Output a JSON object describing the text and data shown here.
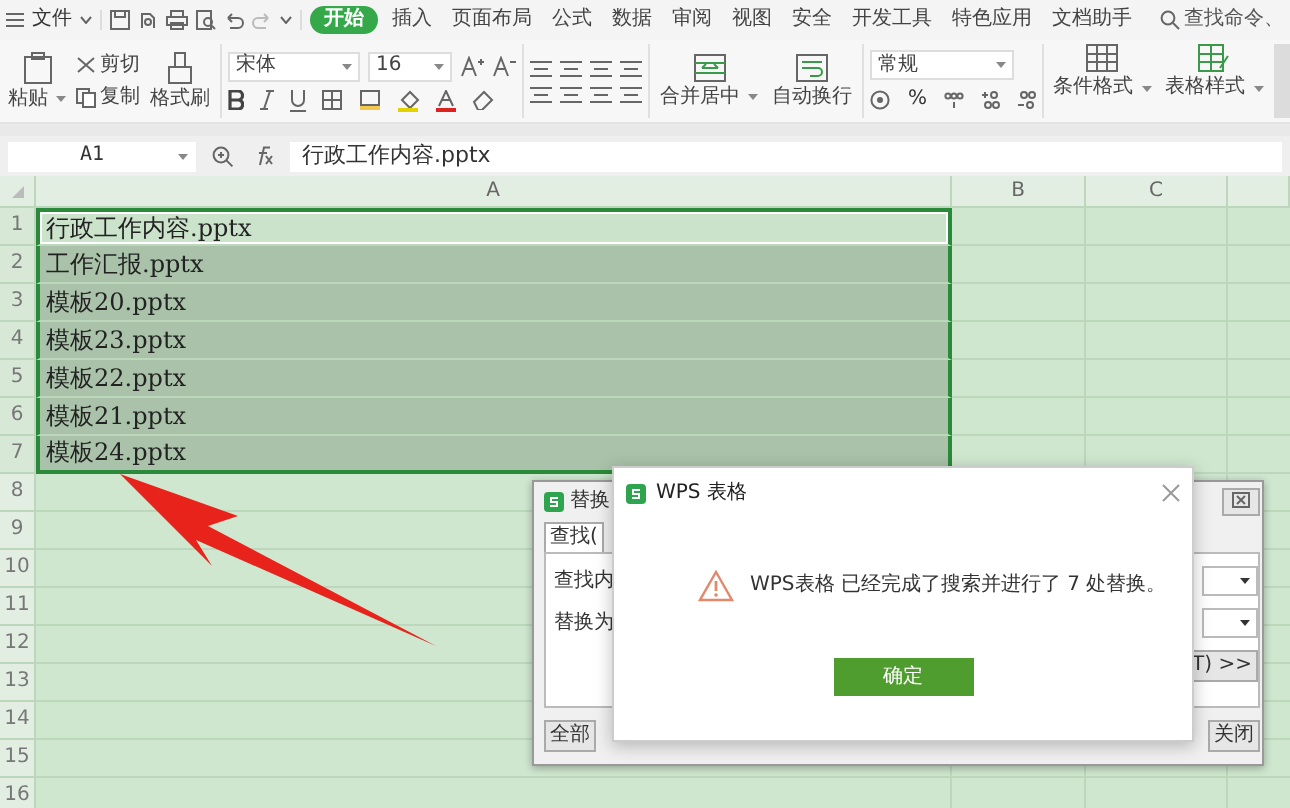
{
  "menu_bar": {
    "file_menu": "文件",
    "tabs": [
      {
        "label": "开始",
        "selected": true
      },
      {
        "label": "插入",
        "selected": false
      },
      {
        "label": "页面布局",
        "selected": false
      },
      {
        "label": "公式",
        "selected": false
      },
      {
        "label": "数据",
        "selected": false
      },
      {
        "label": "审阅",
        "selected": false
      },
      {
        "label": "视图",
        "selected": false
      },
      {
        "label": "安全",
        "selected": false
      },
      {
        "label": "开发工具",
        "selected": false
      },
      {
        "label": "特色应用",
        "selected": false
      },
      {
        "label": "文档助手",
        "selected": false
      }
    ],
    "search": {
      "placeholder": "查找命令、"
    }
  },
  "ribbon": {
    "paste": "粘贴",
    "cut": "剪切",
    "copy": "复制",
    "format_painter": "格式刷",
    "font_name": "宋体",
    "font_size": "16",
    "percent": "%",
    "merge_center": "合并居中",
    "wrap_text": "自动换行",
    "number_format": "常规",
    "conditional_format": "条件格式",
    "table_style": "表格样式"
  },
  "formula_bar": {
    "name_box": "A1",
    "formula": "行政工作内容.pptx"
  },
  "sheet": {
    "columns": [
      "A",
      "B",
      "C"
    ],
    "rows": [
      {
        "number": "1",
        "cell_a": "行政工作内容.pptx",
        "selected": true,
        "active": true
      },
      {
        "number": "2",
        "cell_a": "工作汇报.pptx",
        "selected": true,
        "active": false
      },
      {
        "number": "3",
        "cell_a": "模板20.pptx",
        "selected": true,
        "active": false
      },
      {
        "number": "4",
        "cell_a": "模板23.pptx",
        "selected": true,
        "active": false
      },
      {
        "number": "5",
        "cell_a": "模板22.pptx",
        "selected": true,
        "active": false
      },
      {
        "number": "6",
        "cell_a": "模板21.pptx",
        "selected": true,
        "active": false
      },
      {
        "number": "7",
        "cell_a": "模板24.pptx",
        "selected": true,
        "active": false
      },
      {
        "number": "8",
        "selected": false,
        "active": false
      },
      {
        "number": "9",
        "selected": false,
        "active": false
      },
      {
        "number": "10",
        "selected": false,
        "active": false
      },
      {
        "number": "11",
        "selected": false,
        "active": false
      },
      {
        "number": "12",
        "selected": false,
        "active": false
      },
      {
        "number": "13",
        "selected": false,
        "active": false
      },
      {
        "number": "14",
        "selected": false,
        "active": false
      },
      {
        "number": "15",
        "selected": false,
        "active": false
      },
      {
        "number": "16",
        "selected": false,
        "active": false
      }
    ]
  },
  "replace_dialog": {
    "title": "替换",
    "tab": "查找(",
    "find_label": "查找内",
    "replace_label": "替换为",
    "options_button": "T) >>",
    "replace_all_button": "全部",
    "close_button": "关闭"
  },
  "message_box": {
    "title": "WPS 表格",
    "message": "WPS表格 已经完成了搜索并进行了 7 处替换。",
    "ok_button": "确定"
  }
}
